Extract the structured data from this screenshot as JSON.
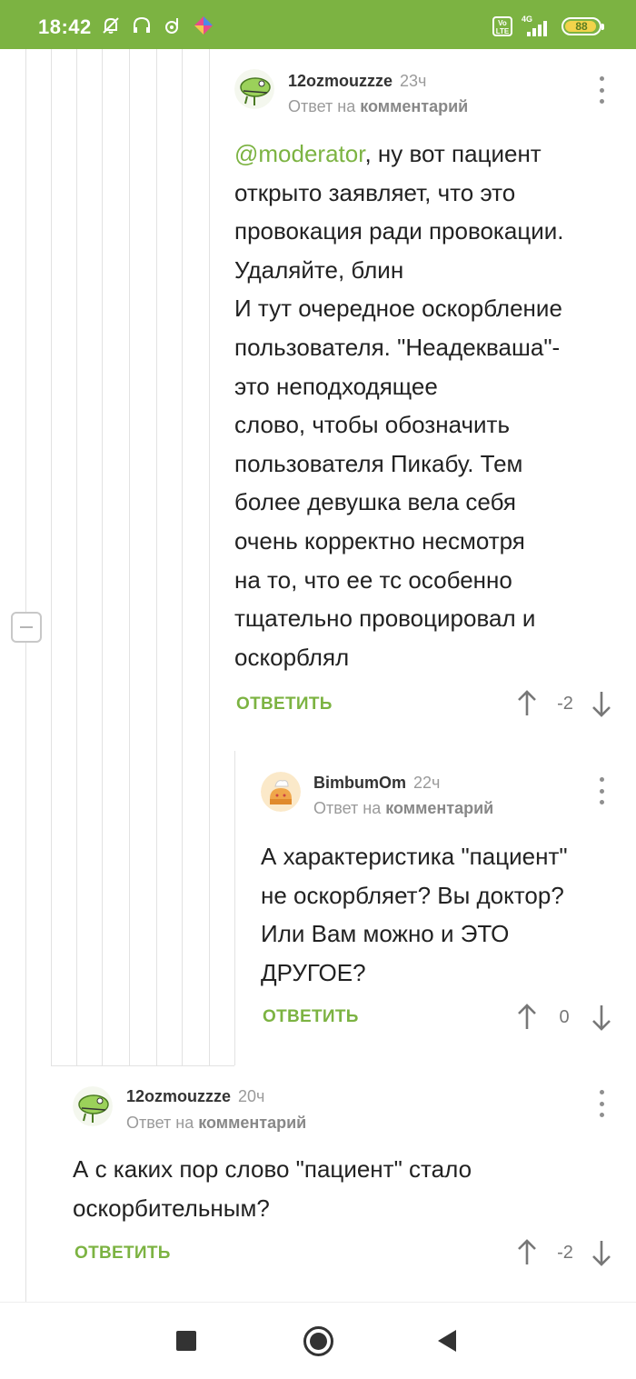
{
  "status_bar": {
    "time": "18:42",
    "network": "4G",
    "volte": "Vo LTE",
    "battery": "88",
    "left_icons": [
      "bell-off-icon",
      "headset-icon",
      "music-note-icon",
      "app-icon"
    ]
  },
  "colors": {
    "accent": "#7cb342",
    "meta_gray": "#9a9a9a",
    "text": "#222222"
  },
  "comments": [
    {
      "author": "12ozmouzzze",
      "time": "23ч",
      "reply_prefix": "Ответ на",
      "reply_target": "комментарий",
      "mention": "@moderator",
      "lines": [
        ", ну вот пациент",
        "открыто заявляет, что это",
        "провокация ради провокации.",
        "Удаляйте, блин",
        "И тут очередное оскорбление",
        "пользователя. \"Неадекваша\"-",
        "это неподходящее",
        "слово, чтобы обозначить",
        "пользователя Пикабу. Тем",
        "более девушка вела себя",
        "очень корректно несмотря",
        "на то, что ее тс особенно",
        "тщательно провоцировал и",
        "оскорблял"
      ],
      "reply_label": "ОТВЕТИТЬ",
      "score": "-2"
    },
    {
      "author": "BimbumOm",
      "time": "22ч",
      "reply_prefix": "Ответ на",
      "reply_target": "комментарий",
      "lines": [
        "А характеристика \"пациент\"",
        "не оскорбляет? Вы доктор?",
        "Или Вам можно и ЭТО",
        "ДРУГОЕ?"
      ],
      "reply_label": "ОТВЕТИТЬ",
      "score": "0"
    },
    {
      "author": "12ozmouzzze",
      "time": "20ч",
      "reply_prefix": "Ответ на",
      "reply_target": "комментарий",
      "lines": [
        "А с каких пор слово \"пациент\" стало",
        "оскорбительным?"
      ],
      "reply_label": "ОТВЕТИТЬ",
      "score": "-2"
    }
  ]
}
